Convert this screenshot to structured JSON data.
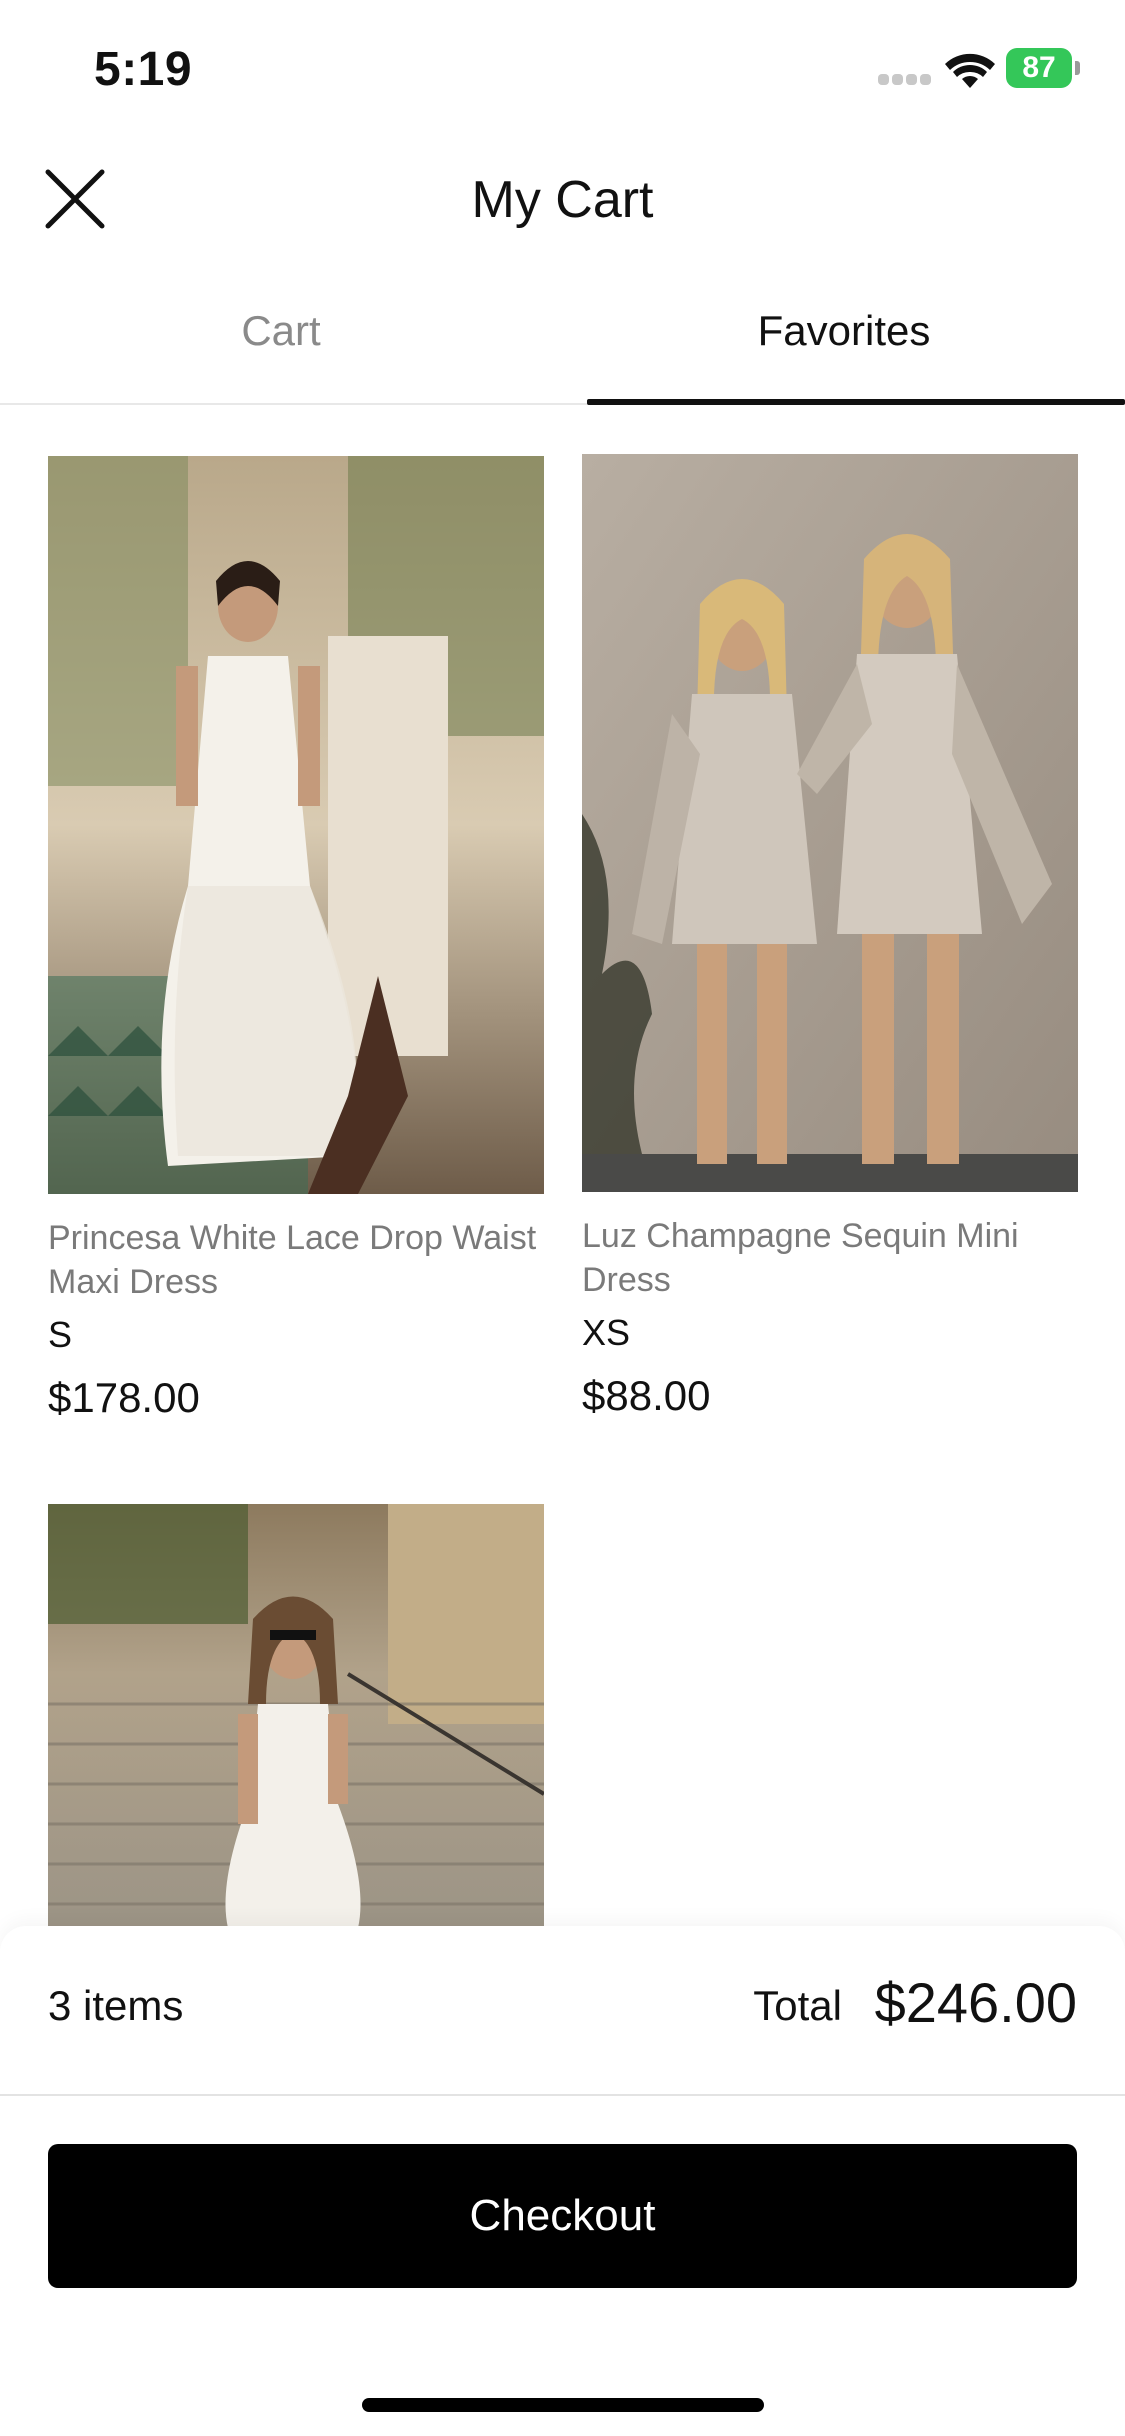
{
  "status_bar": {
    "time": "5:19",
    "battery_percent": "87",
    "battery_color": "#34c759"
  },
  "header": {
    "title": "My Cart",
    "close_icon": "close-icon"
  },
  "tabs": [
    {
      "label": "Cart",
      "active": false
    },
    {
      "label": "Favorites",
      "active": true
    }
  ],
  "products": [
    {
      "name": "Princesa White Lace Drop Waist Maxi Dress",
      "size": "S",
      "price": "$178.00"
    },
    {
      "name": "Luz Champagne Sequin Mini Dress",
      "size": "XS",
      "price": "$88.00"
    },
    {
      "name": "",
      "size": "",
      "price": ""
    }
  ],
  "summary": {
    "item_count": "3 items",
    "total_label": "Total",
    "total_value": "$246.00"
  },
  "checkout": {
    "label": "Checkout"
  },
  "colors": {
    "accent": "#000000",
    "inactive_tab": "#8a8a8a",
    "product_name": "#7a7a7a"
  }
}
